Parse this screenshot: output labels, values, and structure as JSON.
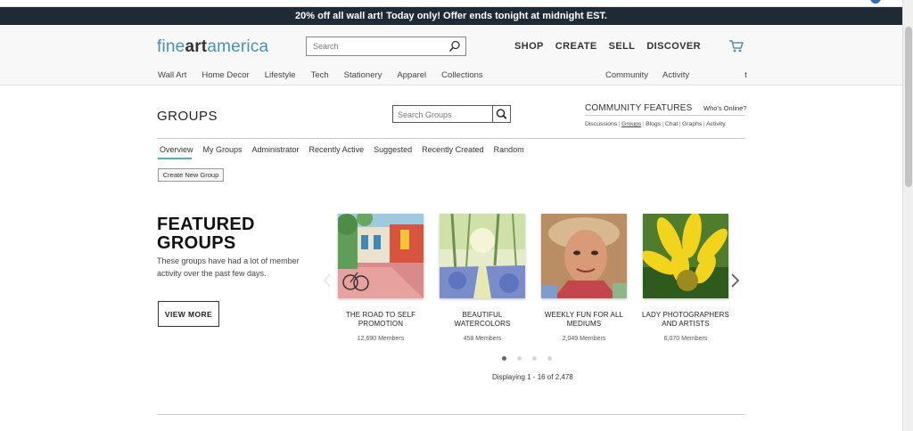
{
  "promo": {
    "text": "20% off all wall art!  Today only!  Offer ends tonight at midnight EST."
  },
  "header": {
    "logo": {
      "part1": "fine",
      "part2": "art",
      "part3": "america"
    },
    "search_placeholder": "Search",
    "nav": [
      "SHOP",
      "CREATE",
      "SELL",
      "DISCOVER"
    ],
    "subnav_left": [
      "Wall Art",
      "Home Decor",
      "Lifestyle",
      "Tech",
      "Stationery",
      "Apparel",
      "Collections"
    ],
    "subnav_right": {
      "community": "Community",
      "activity": "Activity",
      "trailing": "t"
    }
  },
  "groups": {
    "title": "GROUPS",
    "search_placeholder": "Search Groups",
    "community_features": {
      "title": "COMMUNITY FEATURES",
      "whos_online": "Who's Online?",
      "links": [
        "Discussions",
        "Groups",
        "Blogs",
        "Chat",
        "Graphs",
        "Activity"
      ],
      "active_link": "Groups"
    },
    "tabs": [
      "Overview",
      "My Groups",
      "Administrator",
      "Recently Active",
      "Suggested",
      "Recently Created",
      "Random"
    ],
    "active_tab": "Overview",
    "create_button": "Create New Group"
  },
  "featured": {
    "title_line1": "FEATURED",
    "title_line2": "GROUPS",
    "description": "These groups have had a lot of member activity over the past few days.",
    "view_more": "VIEW MORE",
    "cards": [
      {
        "name_line1": "THE ROAD TO SELF",
        "name_line2": "PROMOTION",
        "members": "12,690 Members",
        "thumb": "street-painting"
      },
      {
        "name_line1": "BEAUTIFUL",
        "name_line2": "WATERCOLORS",
        "members": "458 Members",
        "thumb": "forest-watercolor"
      },
      {
        "name_line1": "WEEKLY FUN FOR ALL",
        "name_line2": "MEDIUMS",
        "members": "2,049 Members",
        "thumb": "portrait-painting"
      },
      {
        "name_line1": "LADY PHOTOGRAPHERS",
        "name_line2": "AND ARTISTS",
        "members": "6,070 Members",
        "thumb": "yellow-flower-photo"
      }
    ],
    "pagination_dots": 4,
    "active_dot": 0,
    "displaying": "Displaying 1 - 16 of 2,478"
  },
  "colors": {
    "promo_bg": "#202a36",
    "logo_blue": "#4a90b8",
    "tab_accent": "#48b0c8"
  }
}
